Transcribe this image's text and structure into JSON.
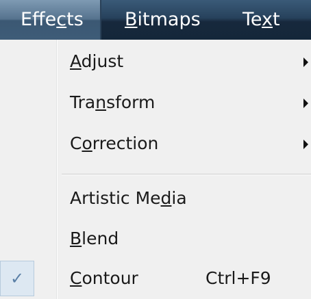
{
  "menubar": {
    "items": [
      {
        "pre": "Effe",
        "u": "c",
        "post": "ts",
        "active": true
      },
      {
        "pre": "",
        "u": "B",
        "post": "itmaps",
        "active": false
      },
      {
        "pre": "Te",
        "u": "x",
        "post": "t",
        "active": false
      }
    ]
  },
  "menu": {
    "items": [
      {
        "pre": "",
        "u": "A",
        "post": "djust",
        "submenu": true
      },
      {
        "pre": "Tra",
        "u": "n",
        "post": "sform",
        "submenu": true
      },
      {
        "pre": "C",
        "u": "o",
        "post": "rrection",
        "submenu": true
      },
      {
        "pre": "Artistic Me",
        "u": "d",
        "post": "ia",
        "submenu": false
      },
      {
        "pre": "",
        "u": "B",
        "post": "lend",
        "submenu": false
      },
      {
        "pre": "",
        "u": "C",
        "post": "ontour",
        "submenu": false,
        "checked": true,
        "shortcut": "Ctrl+F9"
      }
    ],
    "check_glyph": "✓"
  }
}
